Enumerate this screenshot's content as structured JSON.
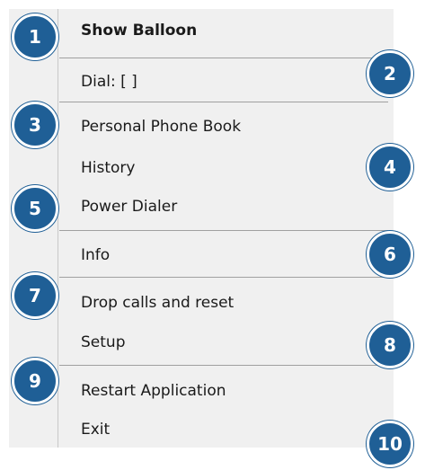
{
  "menu": {
    "items": [
      {
        "label": "Show Balloon",
        "bold": true
      },
      {
        "label": "Dial: [  ]"
      },
      {
        "label": "Personal Phone Book"
      },
      {
        "label": "History"
      },
      {
        "label": "Power Dialer"
      },
      {
        "label": "Info"
      },
      {
        "label": "Drop calls and reset"
      },
      {
        "label": "Setup"
      },
      {
        "label": "Restart Application"
      },
      {
        "label": "Exit"
      }
    ]
  },
  "badges": [
    "1",
    "2",
    "3",
    "4",
    "5",
    "6",
    "7",
    "8",
    "9",
    "10"
  ],
  "colors": {
    "menu_bg": "#f0f0f0",
    "badge": "#1f5f96",
    "text": "#1a1a1a"
  }
}
